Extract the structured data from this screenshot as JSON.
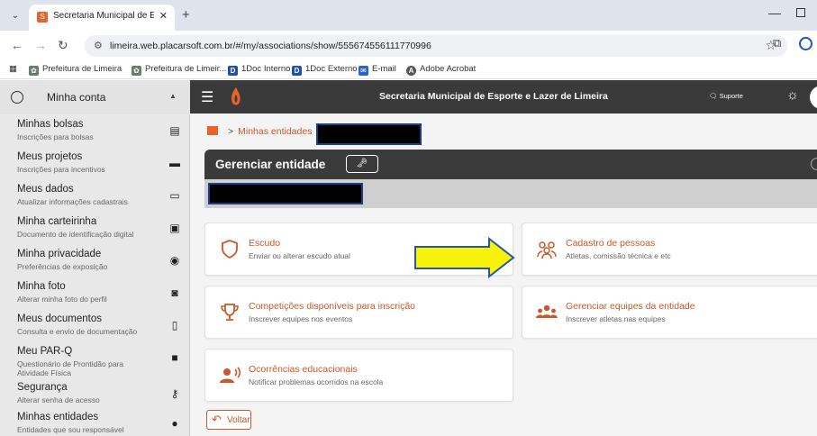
{
  "browser": {
    "tab_title": "Secretaria Municipal de Esporte",
    "url": "limeira.web.placarsoft.com.br/#/my/associations/show/555674556111770996",
    "bookmarks": [
      {
        "label": "Prefeitura de Limeira",
        "icon": "seal-icon"
      },
      {
        "label": "Prefeitura de Limeir...",
        "icon": "seal-icon"
      },
      {
        "label": "1Doc Interno",
        "icon": "doc-icon"
      },
      {
        "label": "1Doc Externo",
        "icon": "doc-icon"
      },
      {
        "label": "E-mail",
        "icon": "mail-icon"
      },
      {
        "label": "Adobe Acrobat",
        "icon": "acrobat-icon"
      }
    ]
  },
  "sidebar": {
    "header": "Minha conta",
    "items": [
      {
        "title": "Minhas bolsas",
        "subtitle": "Inscrições para bolsas",
        "icon": "card-icon"
      },
      {
        "title": "Meus projetos",
        "subtitle": "Inscrições para incentivos",
        "icon": "folder-icon"
      },
      {
        "title": "Meus dados",
        "subtitle": "Atualizar informações cadastrais",
        "icon": "id-card-icon"
      },
      {
        "title": "Minha carteirinha",
        "subtitle": "Documento de identificação digital",
        "icon": "badge-icon"
      },
      {
        "title": "Minha privacidade",
        "subtitle": "Preferências de exposição",
        "icon": "eye-icon"
      },
      {
        "title": "Minha foto",
        "subtitle": "Alterar minha foto do perfil",
        "icon": "camera-icon"
      },
      {
        "title": "Meus documentos",
        "subtitle": "Consulta e envio de documentação",
        "icon": "document-icon"
      },
      {
        "title": "Meu PAR-Q",
        "subtitle": "Questionário de Prontidão para Atividade Física",
        "icon": "file-icon"
      },
      {
        "title": "Segurança",
        "subtitle": "Alterar senha de acesso",
        "icon": "key-icon"
      },
      {
        "title": "Minhas entidades",
        "subtitle": "Entidades que sou responsável",
        "icon": "people-icon"
      }
    ]
  },
  "app": {
    "title": "Secretaria Municipal de Esporte e Lazer de Limeira",
    "support_label": "Suporte"
  },
  "breadcrumb": {
    "sep": ">",
    "link": "Minhas entidades"
  },
  "manager": {
    "title": "Gerenciar entidade",
    "badge_icon": "user-key-icon"
  },
  "cards": [
    {
      "title": "Escudo",
      "subtitle": "Enviar ou alterar escudo atual",
      "icon": "shield-icon"
    },
    {
      "title": "Cadastro de pessoas",
      "subtitle": "Atletas, comissão técnica e etc",
      "icon": "people-group-icon"
    },
    {
      "title": "Competições disponíveis para inscrição",
      "subtitle": "Inscrever equipes nos eventos",
      "icon": "trophy-icon"
    },
    {
      "title": "Gerenciar equipes da entidade",
      "subtitle": "Inscrever atletas nas equipes",
      "icon": "team-icon"
    },
    {
      "title": "Ocorrências educacionais",
      "subtitle": "Notificar problemas ocorridos na escola",
      "icon": "announce-icon"
    }
  ],
  "back_label": "Voltar",
  "colors": {
    "accent": "#c9582a",
    "arrow_fill": "#f7f20a",
    "arrow_stroke": "#2a55a4",
    "topbar": "#3a3a3a"
  }
}
